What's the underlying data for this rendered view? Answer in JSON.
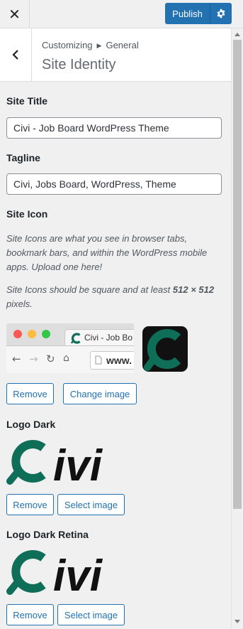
{
  "topbar": {
    "close_icon": "close-icon",
    "publish_label": "Publish",
    "publish_settings_icon": "gear-icon",
    "accent_color": "#2271b1"
  },
  "panel": {
    "back_icon": "chevron-left-icon",
    "breadcrumb_root": "Customizing",
    "breadcrumb_section": "General",
    "title": "Site Identity"
  },
  "site_title": {
    "label": "Site Title",
    "value": "Civi - Job Board WordPress Theme"
  },
  "tagline": {
    "label": "Tagline",
    "value": "Civi, Jobs Board, WordPress, Theme"
  },
  "site_icon": {
    "label": "Site Icon",
    "description": "Site Icons are what you see in browser tabs, bookmark bars, and within the WordPress mobile apps. Upload one here!",
    "size_note_prefix": "Site Icons should be square and at least ",
    "size_note_size": "512 × 512",
    "size_note_suffix": " pixels.",
    "preview_tab_title": "Civi - Job Bo",
    "preview_url": "www.",
    "remove_label": "Remove",
    "change_label": "Change image"
  },
  "logo_dark": {
    "label": "Logo Dark",
    "logo_text": "ivi",
    "remove_label": "Remove",
    "select_label": "Select image"
  },
  "logo_dark_retina": {
    "label": "Logo Dark Retina",
    "logo_text": "ivi",
    "remove_label": "Remove",
    "select_label": "Select image"
  },
  "brand": {
    "green": "#0f6e58",
    "dark": "#111111"
  }
}
